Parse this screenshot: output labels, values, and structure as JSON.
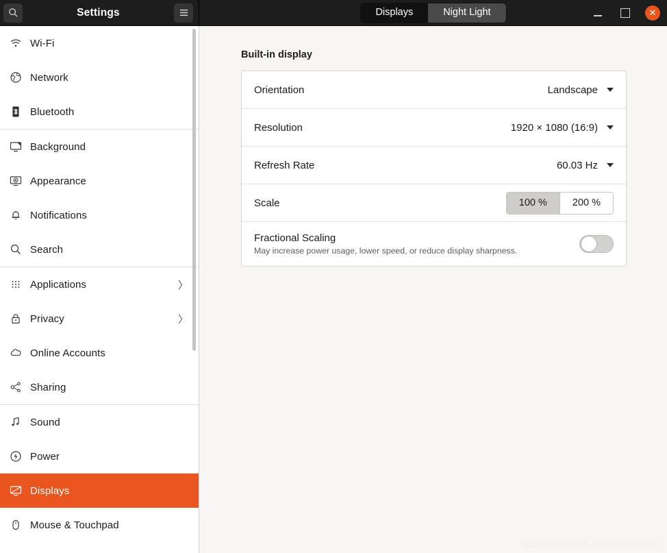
{
  "header": {
    "title": "Settings",
    "search_icon": "search-icon",
    "menu_icon": "hamburger-menu-icon",
    "tabs": [
      {
        "label": "Displays",
        "active": true
      },
      {
        "label": "Night Light",
        "active": false
      }
    ],
    "window_controls": {
      "minimize": "minimize-icon",
      "maximize": "maximize-icon",
      "close": "close-icon",
      "close_glyph": "✕",
      "close_color": "#e9541f"
    }
  },
  "sidebar": {
    "selected_accent": "#e9541f",
    "groups": [
      {
        "items": [
          {
            "label": "Wi-Fi",
            "icon": "wifi-icon",
            "chevron": false,
            "selected": false
          },
          {
            "label": "Network",
            "icon": "network-icon",
            "chevron": false,
            "selected": false
          },
          {
            "label": "Bluetooth",
            "icon": "bluetooth-icon",
            "chevron": false,
            "selected": false
          }
        ]
      },
      {
        "items": [
          {
            "label": "Background",
            "icon": "background-icon",
            "chevron": false,
            "selected": false
          },
          {
            "label": "Appearance",
            "icon": "appearance-icon",
            "chevron": false,
            "selected": false
          },
          {
            "label": "Notifications",
            "icon": "bell-icon",
            "chevron": false,
            "selected": false
          },
          {
            "label": "Search",
            "icon": "search-icon",
            "chevron": false,
            "selected": false
          }
        ]
      },
      {
        "items": [
          {
            "label": "Applications",
            "icon": "grid-dots-icon",
            "chevron": true,
            "selected": false
          },
          {
            "label": "Privacy",
            "icon": "lock-icon",
            "chevron": true,
            "selected": false
          },
          {
            "label": "Online Accounts",
            "icon": "cloud-icon",
            "chevron": false,
            "selected": false
          },
          {
            "label": "Sharing",
            "icon": "share-icon",
            "chevron": false,
            "selected": false
          }
        ]
      },
      {
        "items": [
          {
            "label": "Sound",
            "icon": "music-note-icon",
            "chevron": false,
            "selected": false
          },
          {
            "label": "Power",
            "icon": "power-icon",
            "chevron": false,
            "selected": false
          },
          {
            "label": "Displays",
            "icon": "display-icon",
            "chevron": false,
            "selected": true
          },
          {
            "label": "Mouse & Touchpad",
            "icon": "mouse-icon",
            "chevron": false,
            "selected": false
          }
        ]
      }
    ],
    "chevron_glyph": "〉"
  },
  "main": {
    "section_title": "Built-in display",
    "rows": {
      "orientation": {
        "label": "Orientation",
        "value": "Landscape"
      },
      "resolution": {
        "label": "Resolution",
        "value": "1920 × 1080 (16:9)"
      },
      "refresh_rate": {
        "label": "Refresh Rate",
        "value": "60.03 Hz"
      },
      "scale": {
        "label": "Scale",
        "options": [
          {
            "label": "100 %",
            "selected": true
          },
          {
            "label": "200 %",
            "selected": false
          }
        ]
      },
      "fractional_scaling": {
        "label": "Fractional Scaling",
        "description": "May increase power usage, lower speed, or reduce display sharpness.",
        "enabled": false
      }
    }
  },
  "watermark": "https://blog.csdn.net/a805607966"
}
